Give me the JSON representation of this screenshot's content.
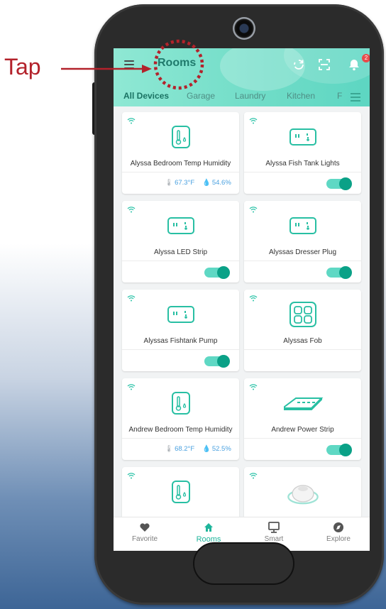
{
  "annotation": {
    "label": "Tap",
    "color": "#b3222b"
  },
  "header": {
    "title": "Rooms",
    "notification_count": "2",
    "tabs": [
      "All Devices",
      "Garage",
      "Laundry",
      "Kitchen",
      "F"
    ]
  },
  "devices": [
    {
      "name": "Alyssa Bedroom Temp Humidity",
      "type": "temp-humidity",
      "temperature": "67.3°F",
      "humidity": "54.6%"
    },
    {
      "name": "Alyssa Fish Tank Lights",
      "type": "plug",
      "toggle": "on"
    },
    {
      "name": "Alyssa LED Strip",
      "type": "plug",
      "toggle": "on"
    },
    {
      "name": "Alyssas Dresser Plug",
      "type": "plug",
      "toggle": "on"
    },
    {
      "name": "Alyssas Fishtank Pump",
      "type": "plug",
      "toggle": "on"
    },
    {
      "name": "Alyssas Fob",
      "type": "fob"
    },
    {
      "name": "Andrew Bedroom Temp Humidity",
      "type": "temp-humidity",
      "temperature": "68.2°F",
      "humidity": "52.5%"
    },
    {
      "name": "Andrew Power Strip",
      "type": "power-strip",
      "toggle": "on"
    },
    {
      "type": "temp-humidity"
    },
    {
      "type": "siren"
    }
  ],
  "bottom_nav": [
    {
      "label": "Favorite",
      "icon": "heart-icon"
    },
    {
      "label": "Rooms",
      "icon": "home-icon",
      "active": true
    },
    {
      "label": "Smart",
      "icon": "monitor-icon"
    },
    {
      "label": "Explore",
      "icon": "compass-icon"
    }
  ],
  "colors": {
    "accent": "#1fb59b",
    "header": "#6fdcc7",
    "toggle_knob": "#0aa187"
  }
}
